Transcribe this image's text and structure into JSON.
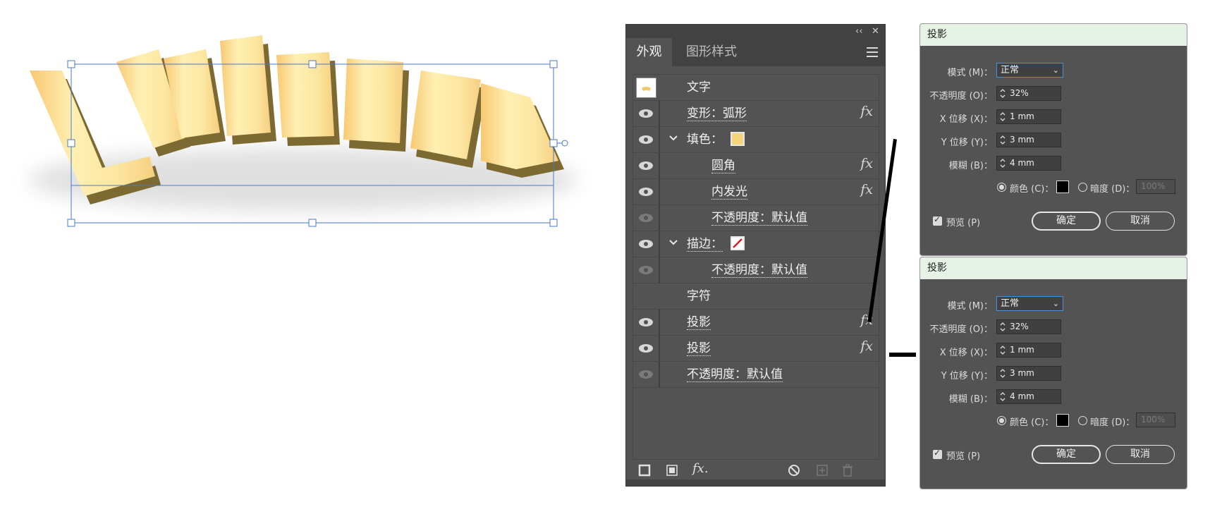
{
  "artwork": {
    "text": "Lntano"
  },
  "panel": {
    "tabs": [
      "外观",
      "图形样式"
    ],
    "collapse_glyph": "‹‹",
    "close_glyph": "✕",
    "rows": {
      "object": "文字",
      "warp": "变形：弧形",
      "fill": "填色：",
      "round": "圆角",
      "inner_glow": "内发光",
      "fill_opacity": "不透明度：默认值",
      "stroke": "描边：",
      "stroke_opacity": "不透明度：默认值",
      "chars": "字符",
      "shadow1": "投影",
      "shadow2": "投影",
      "opacity": "不透明度：默认值"
    },
    "fx_label": "fx",
    "add_effect_label": "fx.",
    "fill_color": "#f6d47c",
    "stroke_color": "#cc1f2a"
  },
  "dialogs": [
    {
      "title": "投影",
      "mode_label": "模式 (M)：",
      "mode": "正常",
      "opacity_label": "不透明度 (O)：",
      "opacity": "32%",
      "x_label": "X 位移 (X)：",
      "x": "1 mm",
      "y_label": "Y 位移 (Y)：",
      "y": "3 mm",
      "blur_label": "模糊 (B)：",
      "blur": "4 mm",
      "color_label": "颜色 (C)：",
      "darkness_label": "暗度 (D)：",
      "darkness": "100%",
      "preview_label": "预览 (P)",
      "ok": "确定",
      "cancel": "取消"
    },
    {
      "title": "投影",
      "mode_label": "模式 (M)：",
      "mode": "正常",
      "opacity_label": "不透明度 (O)：",
      "opacity": "32%",
      "x_label": "X 位移 (X)：",
      "x": "1 mm",
      "y_label": "Y 位移 (Y)：",
      "y": "3 mm",
      "blur_label": "模糊 (B)：",
      "blur": "4 mm",
      "color_label": "颜色 (C)：",
      "darkness_label": "暗度 (D)：",
      "darkness": "100%",
      "preview_label": "预览 (P)",
      "ok": "确定",
      "cancel": "取消"
    }
  ]
}
